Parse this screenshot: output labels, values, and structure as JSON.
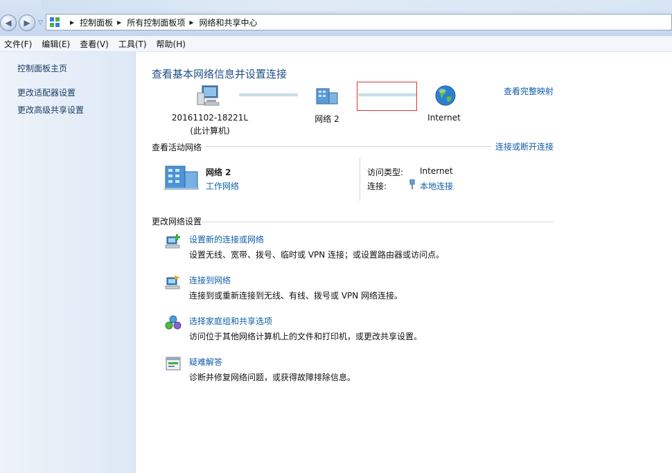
{
  "breadcrumbs": [
    "控制面板",
    "所有控制面板项",
    "网络和共享中心"
  ],
  "menu": [
    "文件(F)",
    "编辑(E)",
    "查看(V)",
    "工具(T)",
    "帮助(H)"
  ],
  "sidebar": {
    "items": [
      {
        "label": "控制面板主页"
      },
      {
        "label": "更改适配器设置"
      },
      {
        "label": "更改高级共享设置"
      }
    ]
  },
  "main": {
    "title": "查看基本网络信息并设置连接",
    "full_map_link": "查看完整映射",
    "map": {
      "computer_name": "20161102-18221L",
      "computer_sub": "(此计算机)",
      "network_name": "网络  2",
      "internet": "Internet"
    },
    "active_section": {
      "title": "查看活动网络",
      "link": "连接或断开连接",
      "network_name": "网络  2",
      "network_type": "工作网络",
      "access_label": "访问类型:",
      "access_value": "Internet",
      "connection_label": "连接:",
      "connection_value": "本地连接"
    },
    "settings_section": {
      "title": "更改网络设置",
      "tasks": [
        {
          "title": "设置新的连接或网络",
          "desc": "设置无线、宽带、拨号、临时或 VPN 连接；或设置路由器或访问点。",
          "icon": "new-connection-icon"
        },
        {
          "title": "连接到网络",
          "desc": "连接到或重新连接到无线、有线、拨号或 VPN 网络连接。",
          "icon": "connect-network-icon"
        },
        {
          "title": "选择家庭组和共享选项",
          "desc": "访问位于其他网络计算机上的文件和打印机，或更改共享设置。",
          "icon": "homegroup-icon"
        },
        {
          "title": "疑难解答",
          "desc": "诊断并修复网络问题，或获得故障排除信息。",
          "icon": "troubleshoot-icon"
        }
      ]
    }
  },
  "colors": {
    "link": "#0f5ea8",
    "title": "#1f4f86",
    "highlight_box": "#e03232"
  }
}
